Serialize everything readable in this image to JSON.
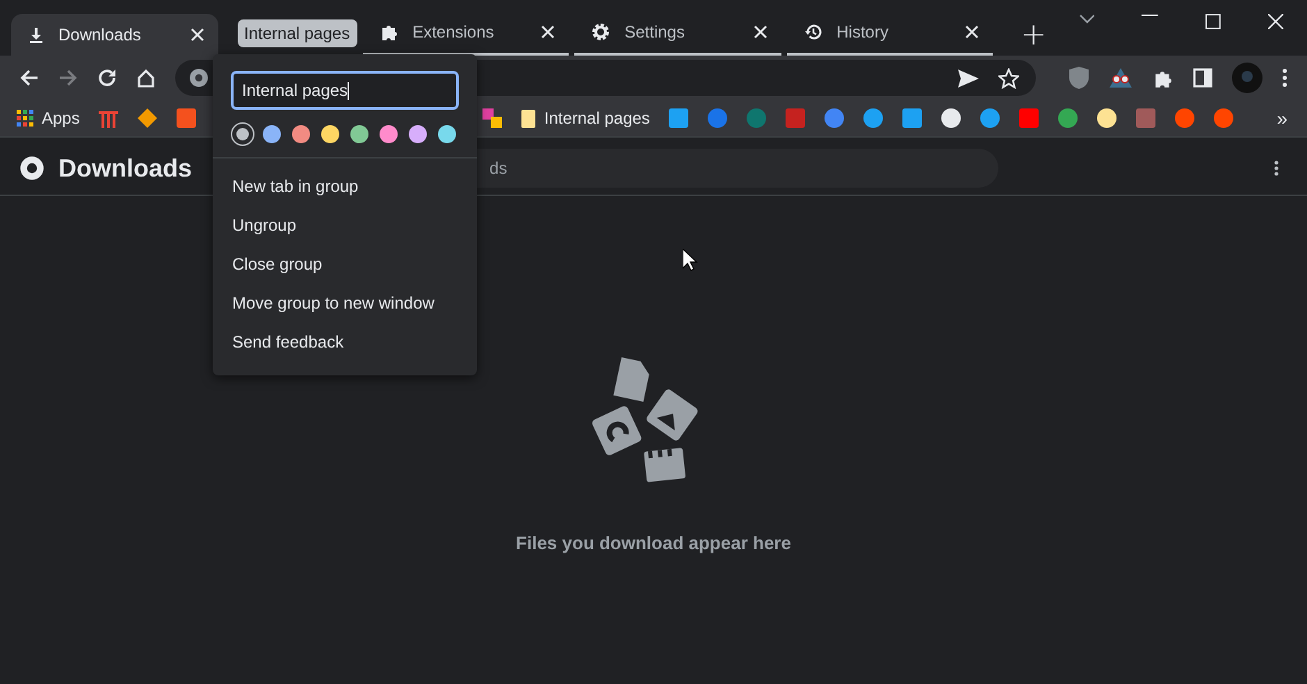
{
  "tab_group": {
    "label": "Internal pages"
  },
  "tabs": [
    {
      "title": "Downloads",
      "selected": true
    },
    {
      "title": "Extensions",
      "selected": false
    },
    {
      "title": "Settings",
      "selected": false
    },
    {
      "title": "History",
      "selected": false
    }
  ],
  "new_tab": "+",
  "toolbar": {
    "forward_disabled": true
  },
  "bookmarks": {
    "apps": "Apps",
    "folder": "Internal pages",
    "overflow": "»"
  },
  "page": {
    "title": "Downloads",
    "search": {
      "placeholder": "ds"
    },
    "empty_message": "Files you download appear here"
  },
  "group_editor": {
    "name": "Internal pages",
    "colors": [
      {
        "color": "#bdc1c6",
        "selected": true
      },
      {
        "color": "#8ab4f8",
        "selected": false
      },
      {
        "color": "#f28b82",
        "selected": false
      },
      {
        "color": "#fdd663",
        "selected": false
      },
      {
        "color": "#81c995",
        "selected": false
      },
      {
        "color": "#ff8bcb",
        "selected": false
      },
      {
        "color": "#d7aefb",
        "selected": false
      },
      {
        "color": "#78d9ec",
        "selected": false
      }
    ],
    "menu": [
      "New tab in group",
      "Ungroup",
      "Close group",
      "Move group to new window",
      "Send feedback"
    ]
  }
}
